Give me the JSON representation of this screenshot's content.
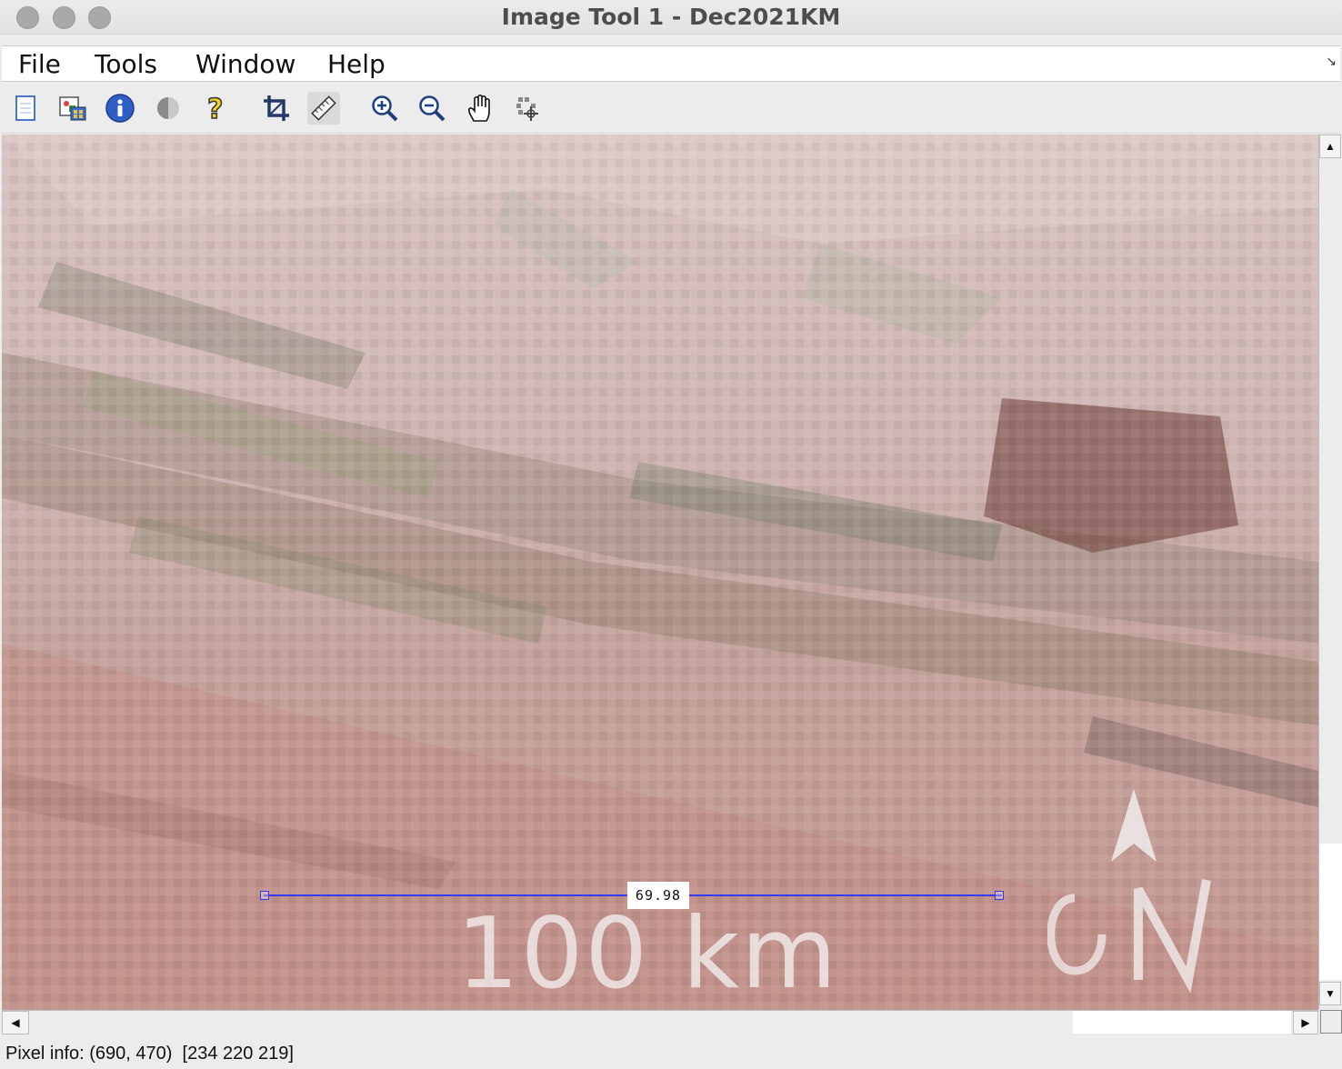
{
  "window": {
    "title": "Image Tool 1 - Dec2021KM"
  },
  "menu": {
    "items": [
      "File",
      "Tools",
      "Window",
      "Help"
    ]
  },
  "toolbar": {
    "buttons": [
      "new-figure-icon",
      "export-image-icon",
      "image-info-icon",
      "adjust-contrast-icon",
      "overview-help-icon",
      "crop-image-icon",
      "measure-distance-icon",
      "zoom-in-icon",
      "zoom-out-icon",
      "pan-icon",
      "pixel-region-icon"
    ]
  },
  "image": {
    "overlay_text": "100 km",
    "measurement": "69.98"
  },
  "status": {
    "pixel_info": "Pixel info: (690, 470)  [234 220 219]"
  },
  "colors": {
    "measure_line": "#3a3af5",
    "terrain_base": "#c9a8a4"
  }
}
